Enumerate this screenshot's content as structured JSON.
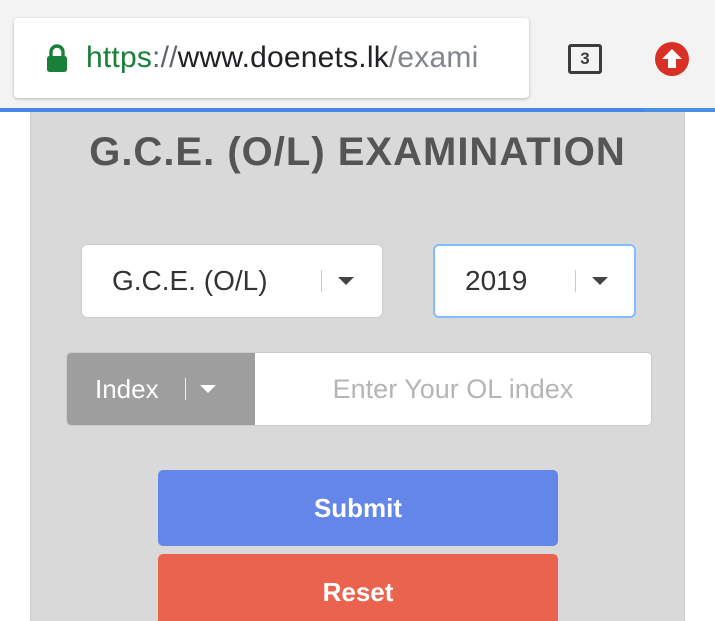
{
  "browser": {
    "url_scheme": "https",
    "url_separator": "://",
    "url_host": "www.doenets.lk",
    "url_path": "/exami",
    "tab_count": "3",
    "icons": {
      "lock": "lock-icon",
      "tabs": "tab-switcher-icon",
      "update": "update-arrow-icon"
    },
    "colors": {
      "lock": "#188038",
      "update": "#d93025"
    },
    "page_load_progress": 0.9
  },
  "page": {
    "title": "G.C.E. (O/L) EXAMINATION",
    "exam_select": {
      "value": "G.C.E. (O/L)"
    },
    "year_select": {
      "value": "2019"
    },
    "index_type": {
      "label": "Index"
    },
    "index_input": {
      "placeholder": "Enter Your OL index",
      "value": ""
    },
    "submit_label": "Submit",
    "reset_label": "Reset",
    "colors": {
      "submit": "#6486e8",
      "reset": "#e9634f",
      "panel": "#d9d9d9"
    }
  }
}
